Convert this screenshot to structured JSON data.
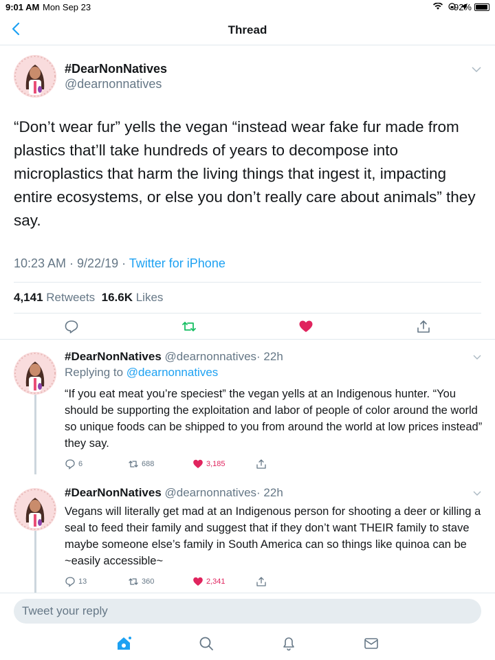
{
  "status_bar": {
    "time": "9:01 AM",
    "date": "Mon Sep 23",
    "battery": "92%"
  },
  "nav": {
    "title": "Thread"
  },
  "main_tweet": {
    "display_name": "#DearNonNatives",
    "handle": "@dearnonnatives",
    "text": "“Don’t wear fur” yells the vegan “instead wear fake fur made from plastics that’ll take hundreds of years to decompose into microplastics that harm the living things that  ingest it, impacting entire ecosystems, or else you don’t really care about animals” they say.",
    "time": "10:23 AM · 9/22/19 · ",
    "source": "Twitter for iPhone",
    "retweet_count": "4,141",
    "retweet_label": "Retweets",
    "like_count": "16.6K",
    "like_label": "Likes"
  },
  "replies": [
    {
      "display_name": "#DearNonNatives",
      "handle": "@dearnonnatives",
      "time": "· 22h",
      "replying_label": "Replying to ",
      "replying_to": "@dearnonnatives",
      "text": "“If you eat meat you’re speciest” the vegan yells at an Indigenous hunter. “You should be supporting the exploitation and labor of people of color around the world so unique foods can be shipped to you from around the world at low prices instead” they say.",
      "replies": "6",
      "retweets": "688",
      "likes": "3,185"
    },
    {
      "display_name": "#DearNonNatives",
      "handle": "@dearnonnatives",
      "time": "· 22h",
      "text": "Vegans will literally get mad at an Indigenous person for shooting a deer or killing a seal to feed their family and suggest that if they don’t want THEIR family to stave maybe someone else’s family in South America can so things like quinoa can be ~easily accessible~",
      "replies": "13",
      "retweets": "360",
      "likes": "2,341"
    }
  ],
  "reply_box": {
    "placeholder": "Tweet your reply"
  },
  "colors": {
    "accent": "#1da1f2",
    "retweet": "#17bf63",
    "like": "#e0245e",
    "muted": "#657786"
  },
  "tab_bar": [
    "home-icon",
    "search-icon",
    "notifications-icon",
    "messages-icon"
  ]
}
